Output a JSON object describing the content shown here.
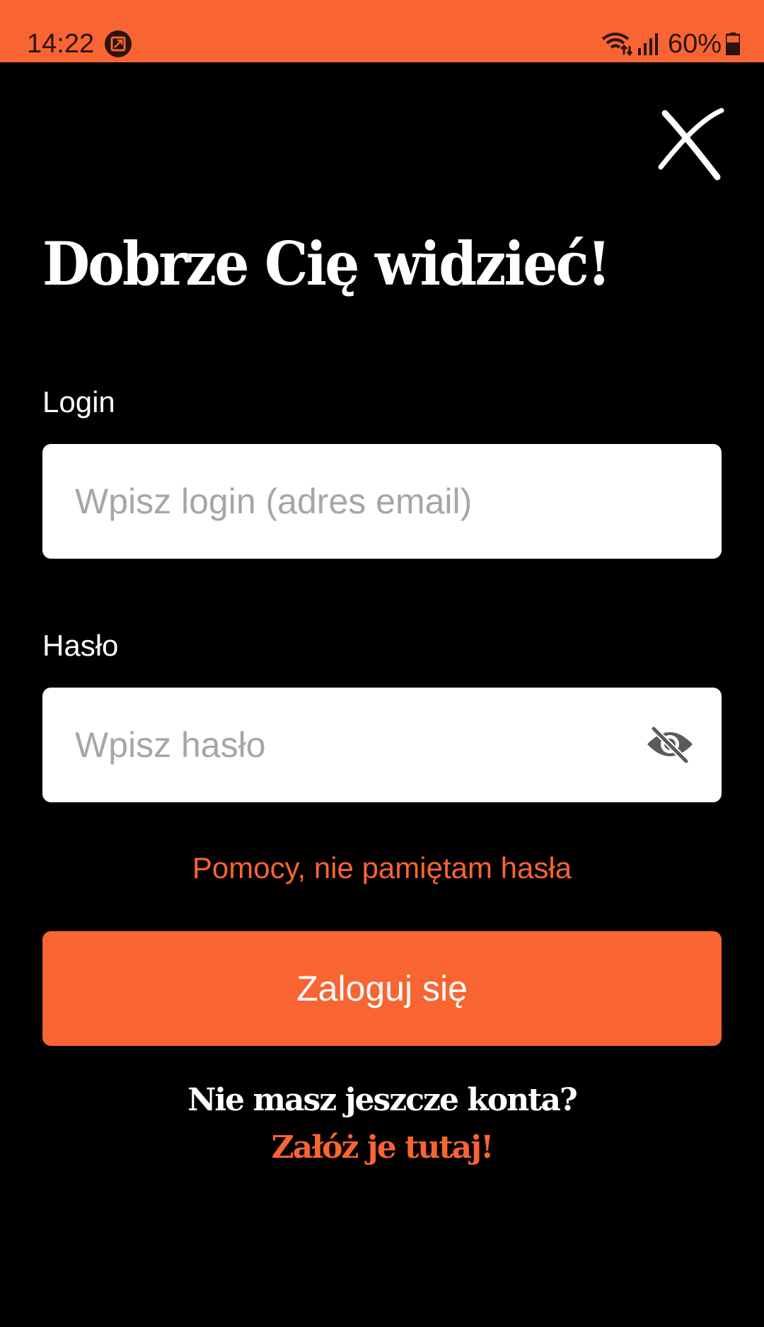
{
  "status_bar": {
    "time": "14:22",
    "battery": "60%",
    "app_icon": "screenshot-app-icon",
    "wifi_icon": "wifi-icon",
    "signal_icon": "signal-icon",
    "battery_icon": "battery-icon",
    "background_color": "#f86432"
  },
  "header": {
    "close_icon": "close-icon"
  },
  "login_form": {
    "title": "Dobrze Cię widzieć!",
    "login_label": "Login",
    "login_placeholder": "Wpisz login (adres email)",
    "login_value": "",
    "password_label": "Hasło",
    "password_placeholder": "Wpisz hasło",
    "password_value": "",
    "password_visibility_icon": "eye-off-icon",
    "forgot_password": "Pomocy, nie pamiętam hasła",
    "submit_label": "Zaloguj się"
  },
  "register": {
    "question": "Nie masz jeszcze konta?",
    "link": "Załóż je tutaj!"
  },
  "colors": {
    "accent": "#f86432",
    "background": "#000000",
    "input_background": "#ffffff",
    "placeholder": "#a6a6a6"
  }
}
